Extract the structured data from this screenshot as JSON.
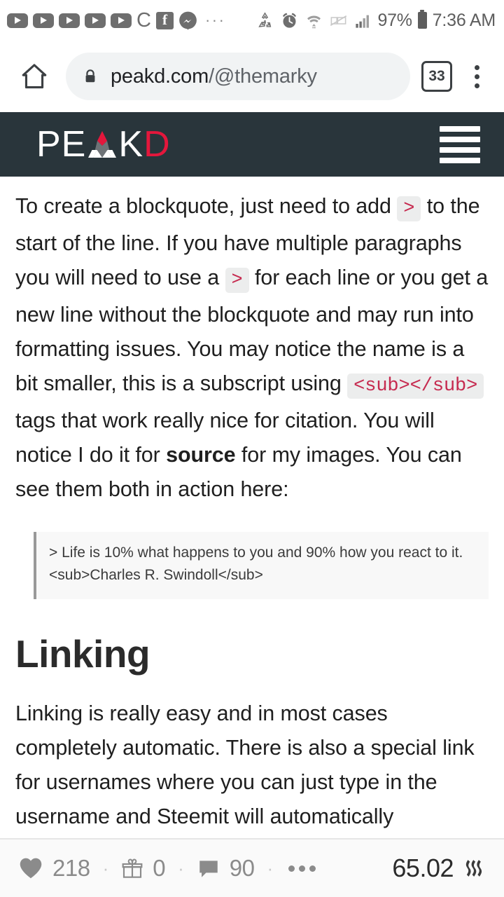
{
  "statusbar": {
    "icons": [
      "youtube-icon",
      "youtube-icon",
      "youtube-icon",
      "youtube-icon",
      "youtube-icon",
      "chrome-icon",
      "facebook-icon",
      "messenger-icon",
      "more-notifications-icon"
    ],
    "chrome_glyph": "C",
    "more_glyph": "···",
    "right_icons": [
      "recycle-icon",
      "alarm-clock-icon",
      "wifi-icon",
      "nfc-off-icon",
      "signal-bars-icon"
    ],
    "battery_percent": "97%",
    "time": "7:36 AM"
  },
  "browser": {
    "home_label": "home-button",
    "url_domain": "peakd.com",
    "url_path": "/@themarky",
    "tab_count": "33",
    "menu_label": "browser-menu"
  },
  "site_header": {
    "logo_pe": "PE",
    "logo_a": "A",
    "logo_k": "K",
    "logo_d": "D",
    "logo_full": "PEAKD",
    "menu_label": "menu",
    "bg_color": "#29353b",
    "accent_color": "#e4173c"
  },
  "article": {
    "paragraph1_parts": [
      "To create a blockquote, just need to add ",
      ">",
      " to the start of the line. If you have multiple paragraphs you will need to use a ",
      ">",
      " for each line or you get a new line without the blockquote and may run into formatting issues. You may notice the name is a bit smaller, this is a subscript using ",
      "<sub></sub>",
      " tags that work really nice for citation. You will notice I do it for ",
      "source",
      " for my images. You can see them both in action here:"
    ],
    "code1": ">",
    "code2": ">",
    "code3": "<sub></sub>",
    "bold1": "source",
    "blockquote_line1": "> Life is 10% what happens to you and 90% how you react to it.",
    "blockquote_line2": "<sub>Charles R. Swindoll</sub>",
    "heading2": "Linking",
    "paragraph2": "Linking is really easy and in most cases completely automatic. There is also a special link for usernames where you can just type in the username and Steemit will automatically"
  },
  "footer": {
    "likes": "218",
    "gifts": "0",
    "comments": "90",
    "separator": "·",
    "payout": "65.02",
    "currency_icon": "steem-logo-icon"
  }
}
